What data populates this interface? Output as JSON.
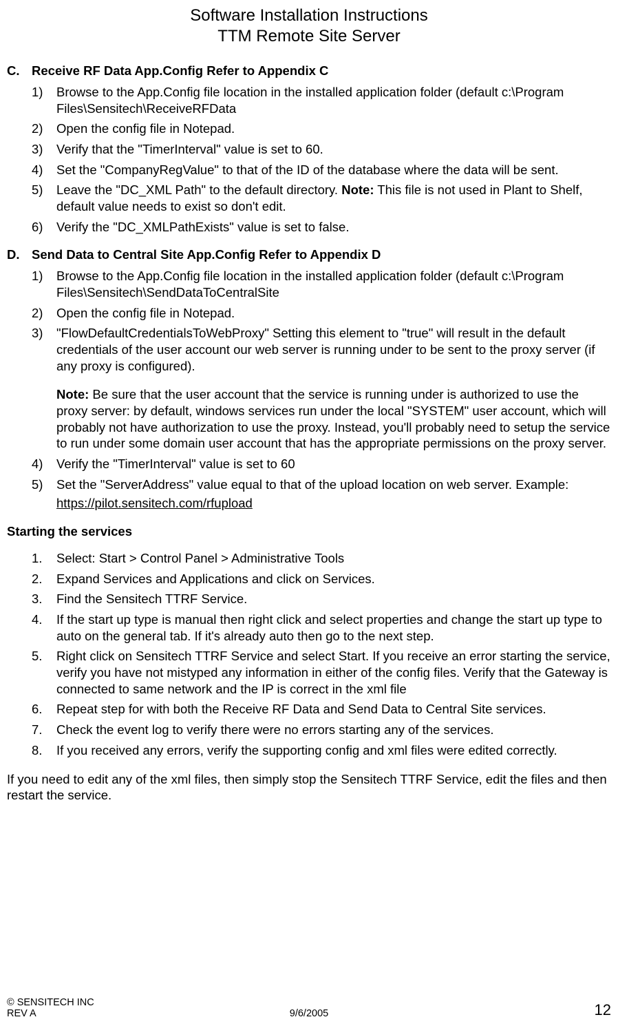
{
  "header": {
    "line1": "Software Installation Instructions",
    "line2": "TTM Remote Site Server"
  },
  "sections": {
    "C": {
      "label": "C.",
      "title": "Receive RF Data App.Config  Refer to Appendix C",
      "items": [
        {
          "num": "1)",
          "text": "Browse to the App.Config file location in the installed application folder (default c:\\Program Files\\Sensitech\\ReceiveRFData"
        },
        {
          "num": "2)",
          "text": "Open the config file in Notepad."
        },
        {
          "num": "3)",
          "text": "Verify that the \"TimerInterval\" value is set to 60."
        },
        {
          "num": "4)",
          "text": "Set the \"CompanyRegValue\" to that of the ID of the database where the data will be sent."
        },
        {
          "num": "5)",
          "text_pre": "Leave the \"DC_XML Path\" to the default directory. ",
          "note": "Note:",
          "text_post": " This file is not used in Plant to Shelf, default value needs to exist so don't edit."
        },
        {
          "num": "6)",
          "text": "Verify the \"DC_XMLPathExists\" value is set to false."
        }
      ]
    },
    "D": {
      "label": "D.",
      "title": "Send Data to Central Site App.Config  Refer to Appendix D",
      "items": [
        {
          "num": "1)",
          "text": "Browse to the App.Config file location in the installed application folder (default c:\\Program Files\\Sensitech\\SendDataToCentralSite"
        },
        {
          "num": "2)",
          "text": "Open the config file in Notepad."
        },
        {
          "num": "3)",
          "text": "\"FlowDefaultCredentialsToWebProxy\"   Setting this element to \"true\" will result in the default credentials of the user account our web server is running under to be sent to the proxy server (if any proxy is configured).",
          "note_block_prefix": "Note:",
          "note_block_text": " Be sure that the user account that the service is running under is authorized to use the proxy server: by default, windows services run under the local \"SYSTEM\" user account, which will probably not have authorization to use the proxy. Instead, you'll probably need to setup the service to run under some domain user account that has the appropriate permissions on the proxy server."
        },
        {
          "num": "4)",
          "text": "Verify the \"TimerInterval\" value is set to 60"
        },
        {
          "num": "5)",
          "text": "Set the \"ServerAddress\" value equal to that of the upload location on web server. Example:",
          "link": "https://pilot.sensitech.com/rfupload"
        }
      ]
    }
  },
  "starting": {
    "heading": "Starting the services",
    "items": [
      {
        "num": "1.",
        "text": "Select: Start > Control Panel > Administrative Tools"
      },
      {
        "num": "2.",
        "text": "Expand Services and Applications and click on Services."
      },
      {
        "num": "3.",
        "text": "Find the Sensitech TTRF Service."
      },
      {
        "num": "4.",
        "text": "If the start up type is manual then right click and select properties and change the start up type to auto on the general tab. If it's already auto then go to the next step."
      },
      {
        "num": "5.",
        "text": "Right click on Sensitech TTRF Service and select Start. If you receive an error starting the service, verify you have not mistyped any information in either of the config files. Verify that the Gateway is connected to same network and the IP is correct in the xml file"
      },
      {
        "num": "6.",
        "text": "Repeat step for with both the Receive RF Data and Send Data to Central Site services."
      },
      {
        "num": "7.",
        "text": "Check the event log to verify there were no errors starting any of the services."
      },
      {
        "num": "8.",
        "text": "If you received any errors, verify the supporting config and xml files were edited correctly."
      }
    ]
  },
  "closing": "If you need to edit any of the xml files, then simply stop the Sensitech TTRF Service, edit the files and then restart the service.",
  "footer": {
    "copyright": "© SENSITECH INC",
    "rev": "REV A",
    "date": "9/6/2005",
    "page": "12"
  }
}
